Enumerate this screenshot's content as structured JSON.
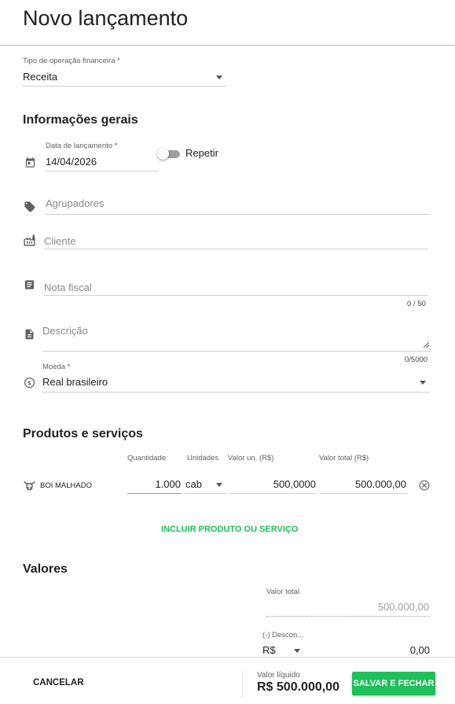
{
  "page": {
    "title": "Novo lançamento"
  },
  "operation_type": {
    "label": "Tipo de operação financeira *",
    "value": "Receita"
  },
  "general": {
    "section_title": "Informações gerais",
    "date": {
      "label": "Data de lançamento *",
      "value": "14/04/2026",
      "icon": "calendar-icon"
    },
    "repeat": {
      "label": "Repetir",
      "enabled": false
    },
    "groupers": {
      "placeholder": "Agrupadores",
      "icon": "tag-icon"
    },
    "client": {
      "placeholder": "Cliente",
      "icon": "factory-icon"
    },
    "invoice": {
      "placeholder": "Nota fiscal",
      "counter": "0 / 50",
      "icon": "receipt-icon"
    },
    "description": {
      "placeholder": "Descrição",
      "counter": "0/5000",
      "icon": "description-icon"
    },
    "currency": {
      "label": "Moeda *",
      "value": "Real brasileiro",
      "icon": "currency-icon"
    }
  },
  "products": {
    "section_title": "Produtos e serviços",
    "columns": {
      "quantity": "Quantidade",
      "units": "Unidades",
      "unit_value": "Valor un. (R$)",
      "total_value": "Valor total (R$)"
    },
    "items": [
      {
        "name": "BOI MALHADO",
        "quantity": "1.000",
        "unit": "cab",
        "unit_value": "500,0000",
        "total_value": "500.000,00",
        "icon": "cow-icon"
      }
    ],
    "add_label": "INCLUIR PRODUTO OU SERVIÇO"
  },
  "values": {
    "section_title": "Valores",
    "total": {
      "label": "Valor total",
      "value": "500.000,00"
    },
    "discount": {
      "label": "(-) Descon...",
      "currency": "R$",
      "value": "0,00"
    }
  },
  "footer": {
    "cancel_label": "CANCELAR",
    "net_label": "Valor líquido",
    "net_value": "R$ 500.000,00",
    "save_label": "SALVAR E FECHAR"
  },
  "colors": {
    "accent": "#1fbf5a",
    "text": "#212121",
    "muted": "#8a8a8a"
  }
}
